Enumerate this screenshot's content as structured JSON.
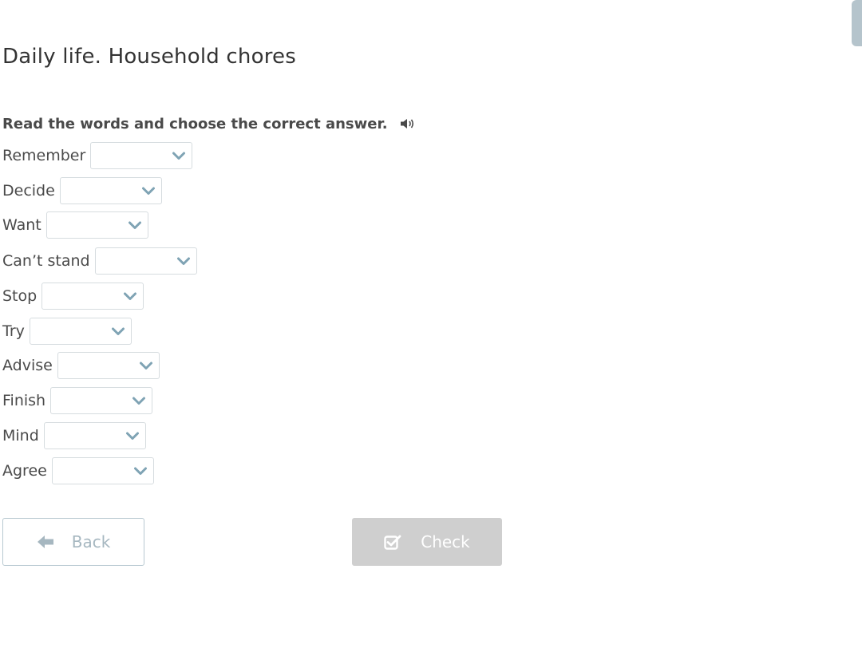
{
  "page": {
    "title": "Daily life. Household chores"
  },
  "exercise": {
    "instruction": "Read the words and choose the correct answer.",
    "audio_icon": "speaker-icon",
    "items": [
      {
        "word": "Remember",
        "selected": ""
      },
      {
        "word": "Decide",
        "selected": ""
      },
      {
        "word": "Want",
        "selected": ""
      },
      {
        "word": "Can’t stand",
        "selected": ""
      },
      {
        "word": "Stop",
        "selected": ""
      },
      {
        "word": "Try",
        "selected": ""
      },
      {
        "word": "Advise",
        "selected": ""
      },
      {
        "word": "Finish",
        "selected": ""
      },
      {
        "word": "Mind",
        "selected": ""
      },
      {
        "word": "Agree",
        "selected": ""
      }
    ]
  },
  "footer": {
    "back_label": "Back",
    "back_icon": "arrow-left-icon",
    "check_label": "Check",
    "check_icon": "checkbox-icon",
    "check_enabled": false
  },
  "colors": {
    "chevron": "#7fa3b4",
    "back_text": "#a6b7c0",
    "check_bg_disabled": "#cfcfcf"
  }
}
